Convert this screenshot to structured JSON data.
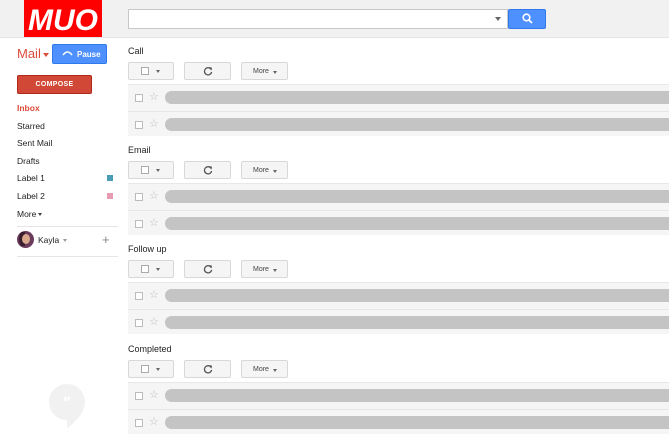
{
  "logo": {
    "text": "MUO"
  },
  "search": {
    "value": "",
    "placeholder": ""
  },
  "sidebar": {
    "mail_title": "Mail",
    "pause_label": "Pause",
    "compose_label": "COMPOSE",
    "items": [
      {
        "label": "Inbox",
        "active": true
      },
      {
        "label": "Starred"
      },
      {
        "label": "Sent Mail"
      },
      {
        "label": "Drafts"
      },
      {
        "label": "Label 1",
        "color": "#4a9db5"
      },
      {
        "label": "Label 2",
        "color": "#e89cb3"
      },
      {
        "label": "More"
      }
    ],
    "user_name": "Kayla"
  },
  "toolbar": {
    "more_label": "More"
  },
  "sections": [
    {
      "title": "Call"
    },
    {
      "title": "Email"
    },
    {
      "title": "Follow up"
    },
    {
      "title": "Completed"
    }
  ],
  "colors": {
    "accent": "#dd4b39",
    "primary_button": "#4d90fe",
    "compose": "#d14836",
    "logo_bg": "#ff0000"
  }
}
